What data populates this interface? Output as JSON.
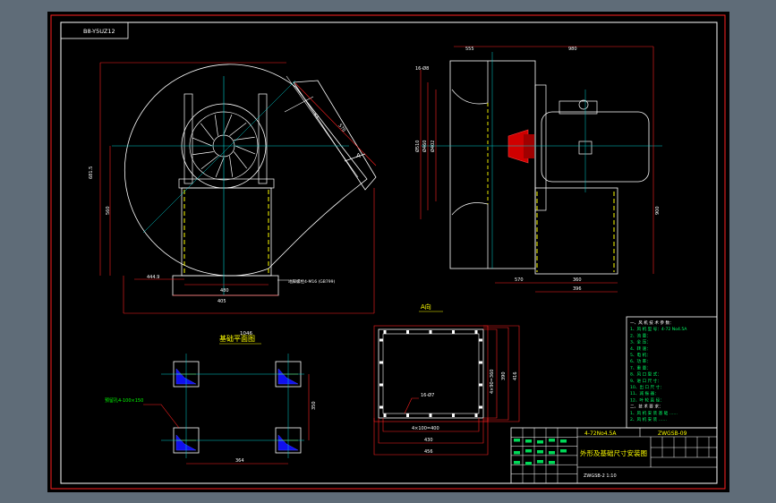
{
  "drawing": {
    "stamp_top_left": "B8-Y5UZ12",
    "view_a_label": "A向",
    "foundation_plan_title": "基础平面图",
    "arrow_label_a": "A",
    "notes": [
      "一、风 机 技 术 参 数：",
      "1、风 机 型 号：4-72 No4.5A",
      "2、流 量：",
      "3、全 压：",
      "4、转 速：",
      "5、电 机：",
      "6、功 率：",
      "7、重 量：",
      "8、风 口 型 式：",
      "9、进 口 尺 寸：",
      "10、出 口 尺 寸：",
      "11、减 振 器：",
      "12、叶 轮 直 径：",
      "二、技 术 要 求：",
      "1、风 机 安 装 基 础 ……",
      "2、风 机 安 装 ……"
    ],
    "title_block": {
      "model": "4-72No4.5A",
      "drawing_no": "ZWGSB-09",
      "title": "外形及基础尺寸安装图",
      "bottom_code": "ZWGSB-2 1:10"
    },
    "dims_side": {
      "d1": "865",
      "d2": "810",
      "d3": "1046",
      "d4": "480",
      "d5": "405",
      "d6": "444.9",
      "d7": "681.5",
      "d8": "560",
      "d9": "570",
      "d10": "63",
      "note": "地脚螺栓4-M16 (GB799)"
    },
    "dims_front": {
      "top1": "555",
      "top2": "980",
      "hole": "16-Ø8",
      "h1": "Ø510",
      "h2": "Ø460",
      "h3": "Ø402",
      "side": "900",
      "b1": "570",
      "b2": "360",
      "b3": "396"
    },
    "dims_view_a": {
      "w1": "4×100=400",
      "w2": "430",
      "w3": "456",
      "h1": "4×90=360",
      "h2": "390",
      "h3": "416",
      "hole": "16-Ø7"
    },
    "dims_foundation": {
      "bolt": "预留孔4-100×150",
      "w": "364",
      "h": "350"
    }
  }
}
